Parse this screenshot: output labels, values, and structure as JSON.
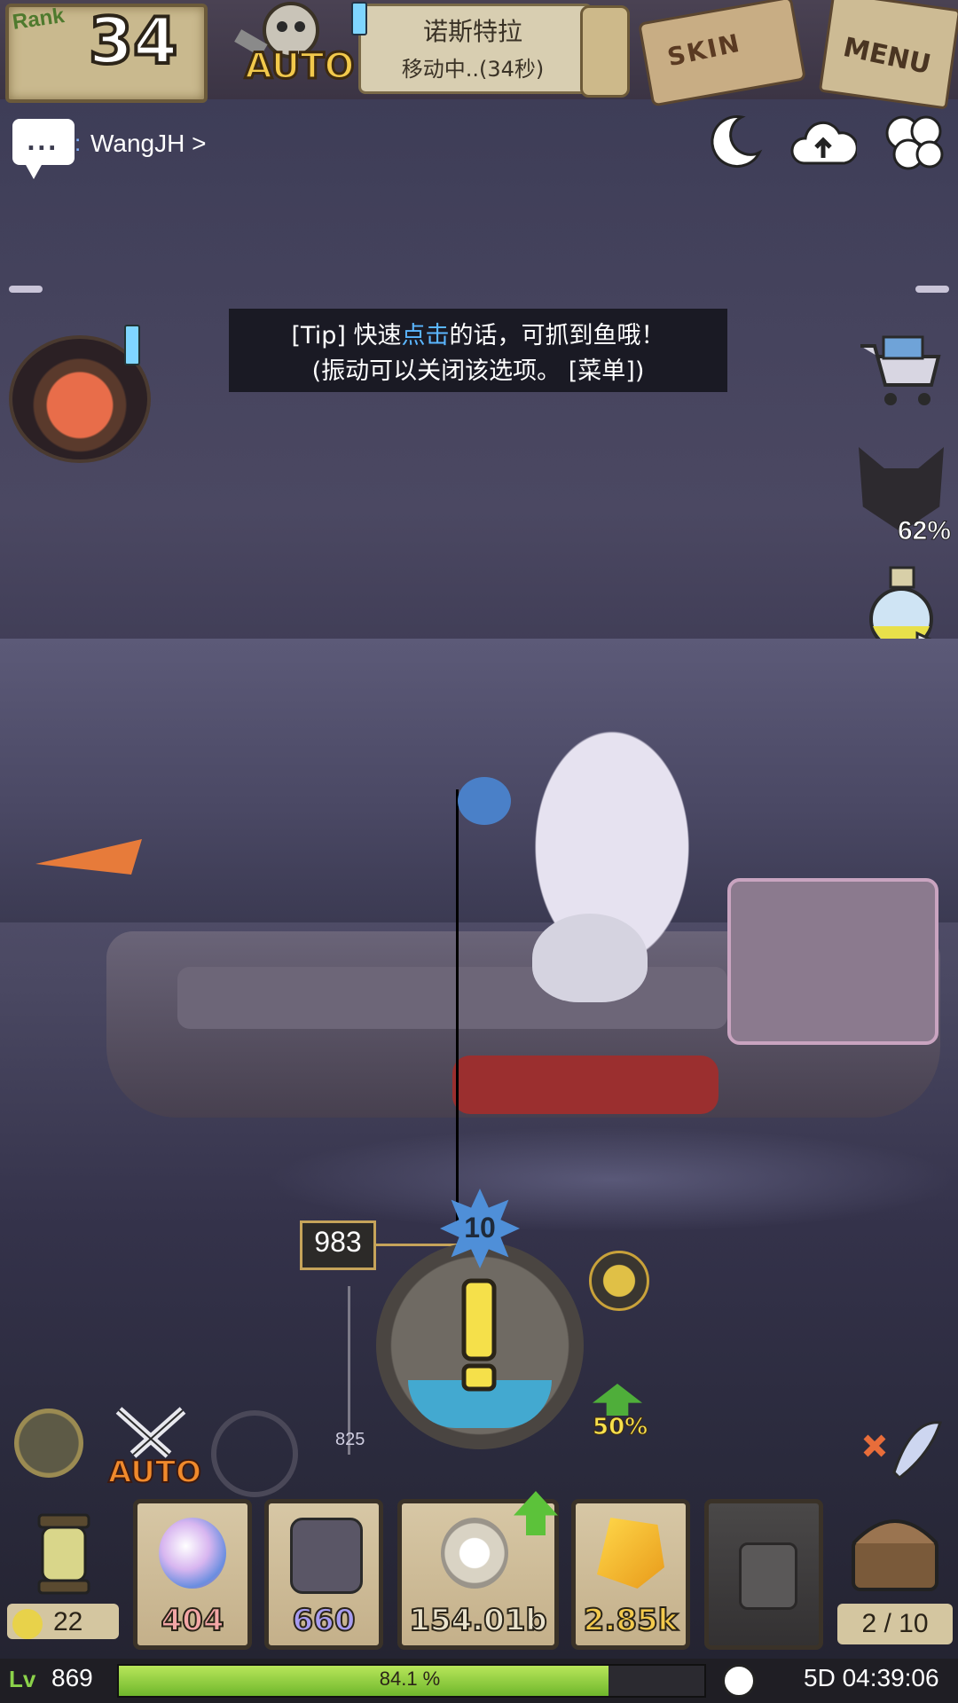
{
  "topbar": {
    "rank_label": "Rank",
    "rank_value": "34",
    "auto_label": "AUTO",
    "destination_name": "诺斯特拉",
    "destination_status": "移动中..(34秒)",
    "skin_label": "SKIN",
    "menu_label": "MENU"
  },
  "chat": {
    "dots": "...",
    "separator": ":",
    "user": "WangJH >"
  },
  "tip": {
    "prefix": "[Tip] 快速",
    "highlight": "点击",
    "suffix": "的话，可抓到鱼哦！",
    "line2": "(振动可以关闭该选项。 [菜单])"
  },
  "side": {
    "fox_percent": "62%"
  },
  "fishing": {
    "count": "983",
    "level_star": "10",
    "scale_value": "825",
    "boost_percent": "50%",
    "auto_label": "AUTO"
  },
  "inventory": {
    "lantern_count": "22",
    "slots": [
      {
        "value": "404",
        "color": "#f3a6a6",
        "icon": "rainbow-orb-icon"
      },
      {
        "value": "660",
        "color": "#a79cf0",
        "icon": "dark-shield-icon"
      },
      {
        "value": "154.01b",
        "color": "#e9e2cc",
        "icon": "shell-icon"
      },
      {
        "value": "2.85k",
        "color": "#f2c94c",
        "icon": "gold-ore-icon"
      },
      {
        "value": "",
        "color": "#555",
        "icon": "lock-icon"
      }
    ],
    "chest_count": "2 / 10"
  },
  "status": {
    "level_icon": "Lv",
    "level": "869",
    "xp_percent_text": "84.1 %",
    "xp_fraction": 0.841,
    "time": "5D 04:39:06"
  }
}
